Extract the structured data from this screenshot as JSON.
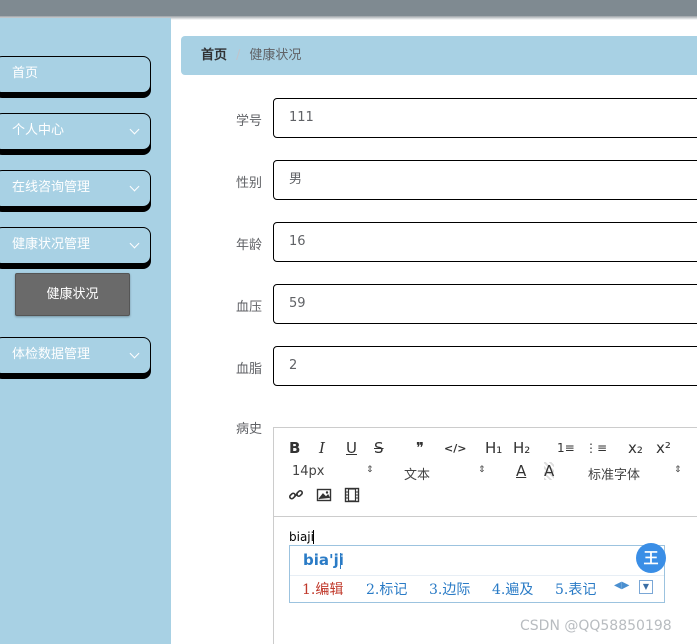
{
  "sidebar": {
    "items": [
      {
        "label": "首页"
      },
      {
        "label": "个人中心"
      },
      {
        "label": "在线咨询管理"
      },
      {
        "label": "健康状况管理"
      },
      {
        "label": "体检数据管理"
      }
    ],
    "submenu": {
      "label": "健康状况"
    }
  },
  "breadcrumb": {
    "home": "首页",
    "separator": "/",
    "current": "健康状况"
  },
  "form": {
    "student_id": {
      "label": "学号",
      "value": "111"
    },
    "gender": {
      "label": "性别",
      "value": "男"
    },
    "age": {
      "label": "年龄",
      "value": "16"
    },
    "blood_pressure": {
      "label": "血压",
      "value": "59"
    },
    "blood_lipid": {
      "label": "血脂",
      "value": "2"
    },
    "history": {
      "label": "病史"
    }
  },
  "editor": {
    "toolbar": {
      "bold": "B",
      "italic": "I",
      "underline": "U",
      "strike": "S",
      "quote": "❞",
      "code": "</>",
      "h1": "H₁",
      "h2": "H₂",
      "ordered_list": "1≡",
      "bullet_list": "⋮≡",
      "subscript": "x₂",
      "superscript": "x²",
      "size": "14px",
      "header": "文本",
      "color": "A",
      "background": "A",
      "font": "标准字体",
      "link_icon": "link-icon",
      "image_icon": "image-icon",
      "video_icon": "video-icon"
    },
    "content": "biaji"
  },
  "ime": {
    "pinyin": "bia'ji",
    "candidates": [
      "1.编辑",
      "2.标记",
      "3.边际",
      "4.遍及",
      "5.表记"
    ],
    "badge": "王",
    "nav": "◀▶",
    "dropdown": "▼"
  },
  "watermark": "CSDN @QQ58850198"
}
